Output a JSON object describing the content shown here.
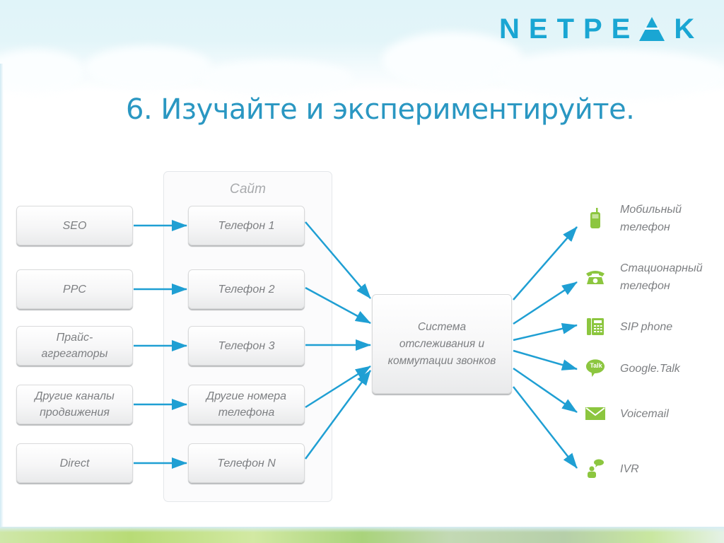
{
  "brand": {
    "logo_text_left": "NETPE",
    "logo_text_right": "K",
    "accent_color": "#1aa6d3"
  },
  "slide": {
    "title": "6.  Изучайте и экспериментируйте."
  },
  "diagram": {
    "group_label": "Сайт",
    "sources": [
      {
        "id": "seo",
        "label": "SEO"
      },
      {
        "id": "ppc",
        "label": "PPC"
      },
      {
        "id": "price",
        "label": "Прайс-\nагрегаторы"
      },
      {
        "id": "other-channels",
        "label": "Другие каналы\nпродвижения"
      },
      {
        "id": "direct",
        "label": "Direct"
      }
    ],
    "phones": [
      {
        "id": "phone-1",
        "label": "Телефон 1"
      },
      {
        "id": "phone-2",
        "label": "Телефон 2"
      },
      {
        "id": "phone-3",
        "label": "Телефон 3"
      },
      {
        "id": "other-numbers",
        "label": "Другие номера\nтелефона"
      },
      {
        "id": "phone-n",
        "label": "Телефон N"
      }
    ],
    "hub": {
      "label": "Система\nотслеживания и\nкоммутации звонков"
    },
    "destinations": [
      {
        "id": "mobile",
        "icon": "mobile-phone-icon",
        "label": "Мобильный\nтелефон"
      },
      {
        "id": "landline",
        "icon": "landline-phone-icon",
        "label": "Стационарный\nтелефон"
      },
      {
        "id": "sip",
        "icon": "sip-phone-icon",
        "label": "SIP phone"
      },
      {
        "id": "gtalk",
        "icon": "google-talk-icon",
        "label": "Google.Talk",
        "icon_text": "Talk"
      },
      {
        "id": "voicemail",
        "icon": "envelope-icon",
        "label": "Voicemail"
      },
      {
        "id": "ivr",
        "icon": "ivr-person-icon",
        "label": "IVR"
      }
    ],
    "colors": {
      "arrow": "#1f9fd3",
      "icon_green": "#8cc63f",
      "node_text": "#7d7f82",
      "group_label": "#a8aaad"
    }
  }
}
